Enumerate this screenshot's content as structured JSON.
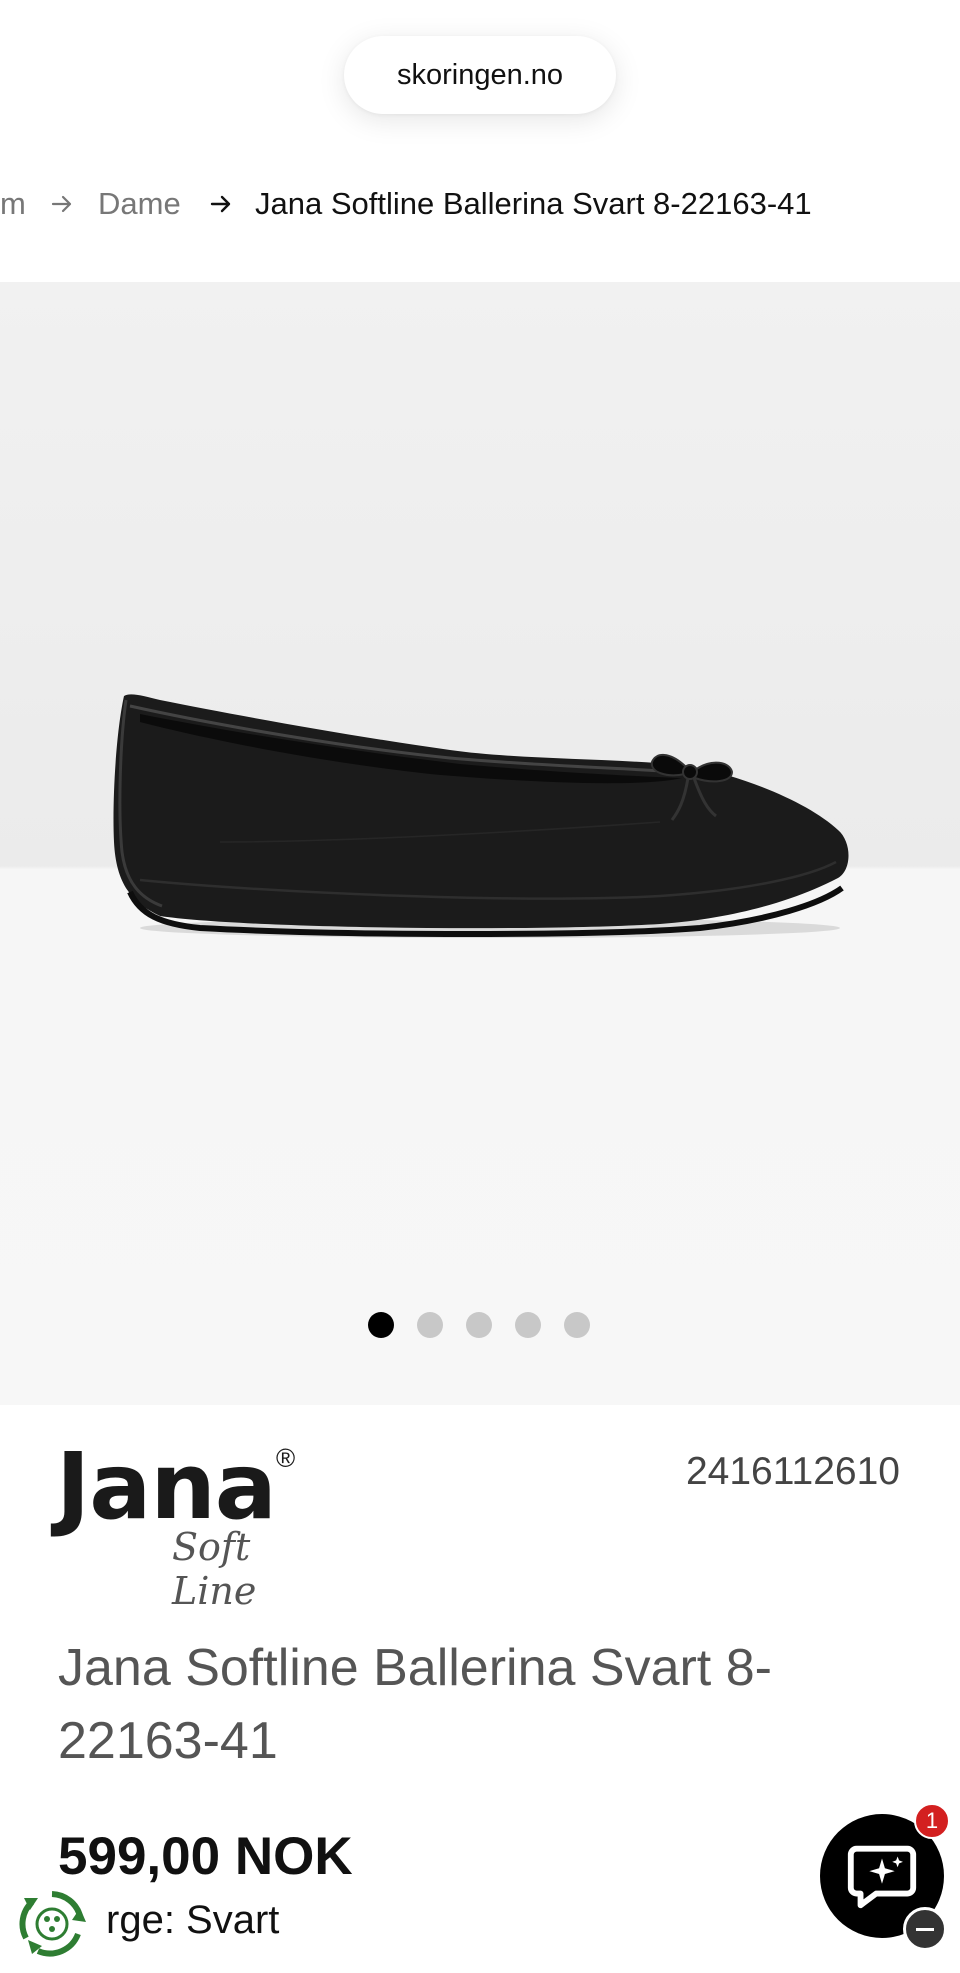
{
  "browser": {
    "url": "skoringen.no"
  },
  "breadcrumb": {
    "items": [
      {
        "label": "m"
      },
      {
        "label": "Dame"
      },
      {
        "label": "Jana Softline Ballerina Svart 8-22163-41"
      }
    ]
  },
  "gallery": {
    "image_alt": "black leather ballerina flat with bow",
    "slide_count": 5,
    "active_slide": 1
  },
  "product": {
    "brand": {
      "name": "Jana",
      "registered_mark": "®",
      "subline": "Soft Line"
    },
    "sku": "2416112610",
    "title": "Jana Softline Ballerina Svart 8-22163-41",
    "price": "599,00 NOK",
    "color_text": "rge: Svart"
  },
  "chat": {
    "unread_count": "1",
    "icon": "chat-sparkle-icon"
  },
  "icons": {
    "breadcrumb_separator": "arrow-right-icon",
    "badge": "recycle-icon"
  },
  "colors": {
    "accent": "#000000",
    "notification": "#d32020",
    "recycle_green": "#2e7d32"
  }
}
